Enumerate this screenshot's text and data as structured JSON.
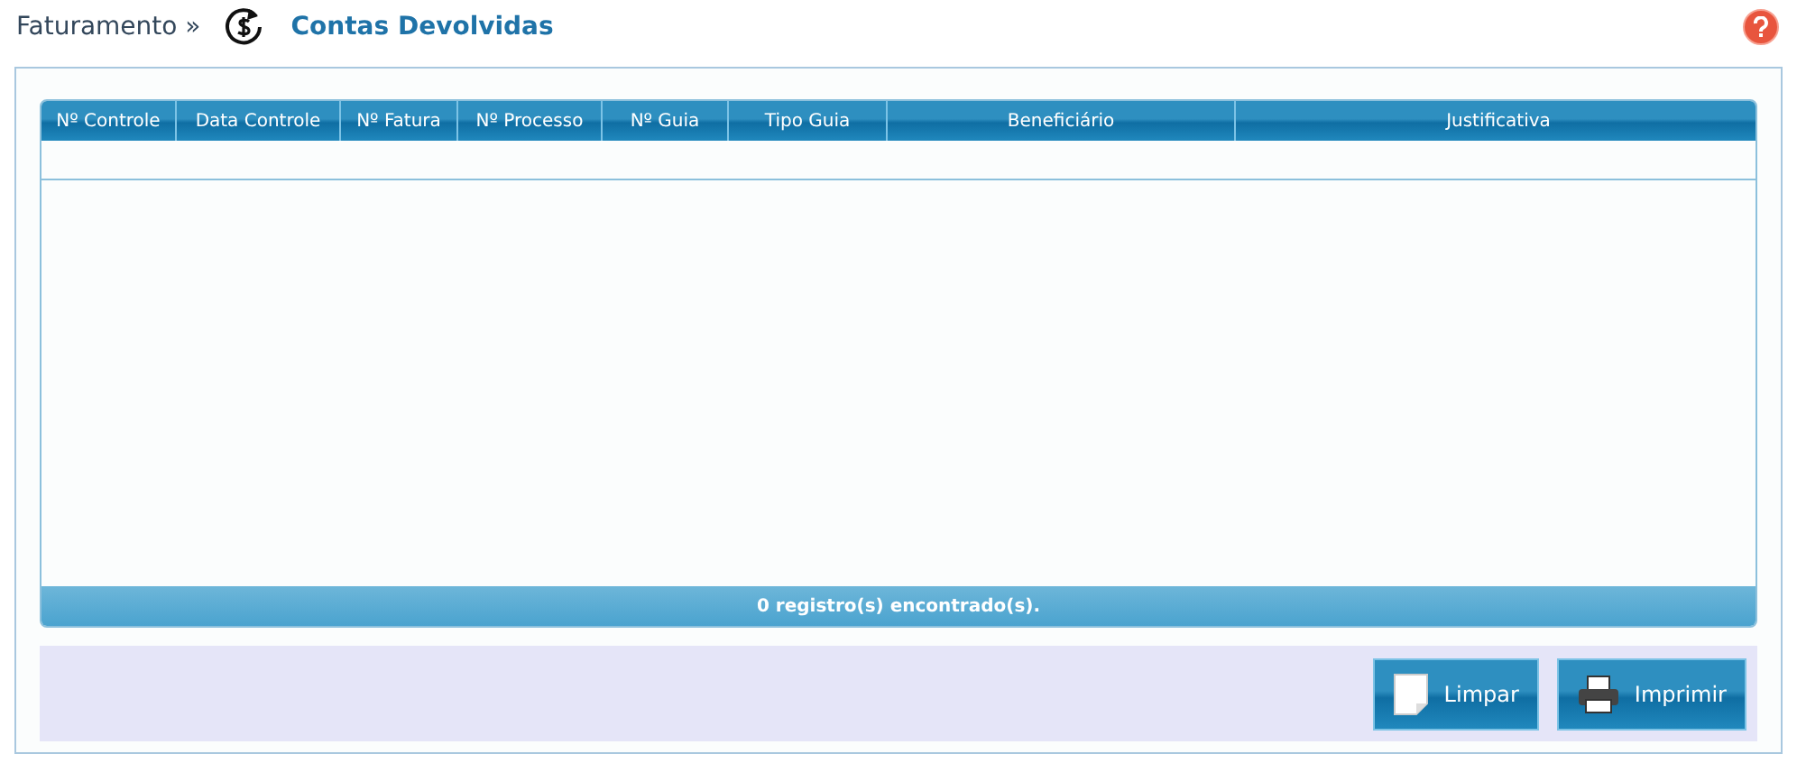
{
  "breadcrumb": {
    "parent": "Faturamento »",
    "title": "Contas Devolvidas"
  },
  "table": {
    "columns": [
      "Nº Controle",
      "Data Controle",
      "Nº Fatura",
      "Nº Processo",
      "Nº Guia",
      "Tipo Guia",
      "Beneficiário",
      "Justificativa"
    ],
    "footer": "0 registro(s) encontrado(s)."
  },
  "buttons": [
    {
      "kind": "clear",
      "label": "Limpar"
    },
    {
      "kind": "print",
      "label": "Imprimir"
    }
  ]
}
